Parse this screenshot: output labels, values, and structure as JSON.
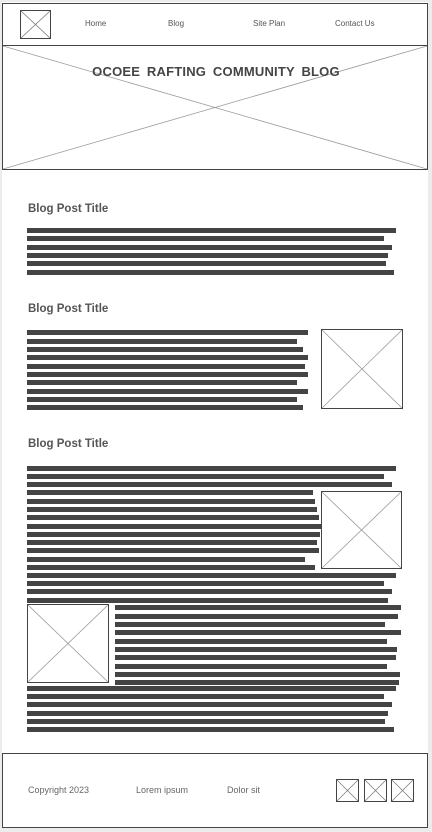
{
  "header": {
    "logo_icon": "placeholder-image-icon",
    "nav": [
      {
        "label": "Home"
      },
      {
        "label": "Blog"
      },
      {
        "label": "Site Plan"
      },
      {
        "label": "Contact Us"
      }
    ]
  },
  "hero": {
    "title": "OCOEE  RAFTING  COMMUNITY  BLOG",
    "image_icon": "placeholder-image-icon"
  },
  "posts": [
    {
      "title": "Blog Post Title",
      "text_lines": 6,
      "images": 0
    },
    {
      "title": "Blog Post Title",
      "text_lines": 10,
      "images": 1
    },
    {
      "title": "Blog Post Title",
      "text_lines": 32,
      "images": 2
    }
  ],
  "footer": {
    "copyright": "Copyright 2023",
    "link1": "Lorem ipsum",
    "link2": "Dolor sit",
    "social_icons": [
      "placeholder-image-icon",
      "placeholder-image-icon",
      "placeholder-image-icon"
    ]
  },
  "colors": {
    "wire": "#444444",
    "text": "#555555",
    "placeholder_cross": "#999999",
    "background": "#ececec"
  }
}
